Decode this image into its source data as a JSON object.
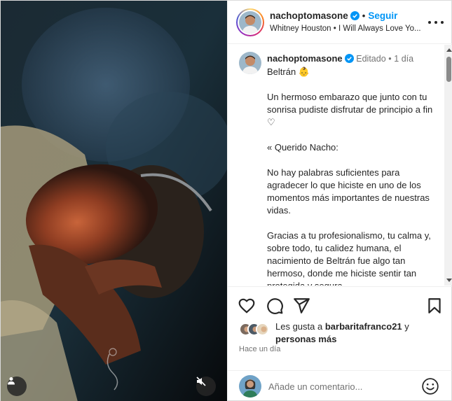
{
  "post": {
    "username": "nachoptomasone",
    "follow_label": "Seguir",
    "separator": "•",
    "audio": "Whitney Houston • I Will Always Love Yo..."
  },
  "caption": {
    "username": "nachoptomasone",
    "edited": "Editado",
    "separator": "•",
    "time": "1 día",
    "first_line": "Beltrán 👶",
    "paragraphs": [
      "Un hermoso embarazo que junto con tu sonrisa pudiste disfrutar de principio a fin ♡",
      "« Querido Nacho:",
      "No hay palabras suficientes para agradecer lo que hiciste en uno de los momentos más importantes de nuestras vidas.",
      "Gracias a tu profesionalismo, tu calma y, sobre todo, tu calidez humana, el nacimiento de Beltrán fue algo tan hermoso, donde me hiciste sentir tan protegida y segura."
    ]
  },
  "likes": {
    "prefix": "Les gusta a",
    "user": "barbaritafranco21",
    "joiner": "y",
    "others": "personas más"
  },
  "time_ago": "Hace un día",
  "comment": {
    "placeholder": "Añade un comentario..."
  },
  "icons": {
    "like": "heart-icon",
    "comment": "comment-icon",
    "share": "share-icon",
    "save": "bookmark-icon",
    "emoji": "emoji-icon",
    "tag": "person-tag-icon",
    "mute": "speaker-muted-icon",
    "verified": "verified-badge-icon",
    "more": "more-options-icon"
  },
  "colors": {
    "accent": "#0095f6",
    "text": "#262626",
    "muted": "#737373"
  }
}
